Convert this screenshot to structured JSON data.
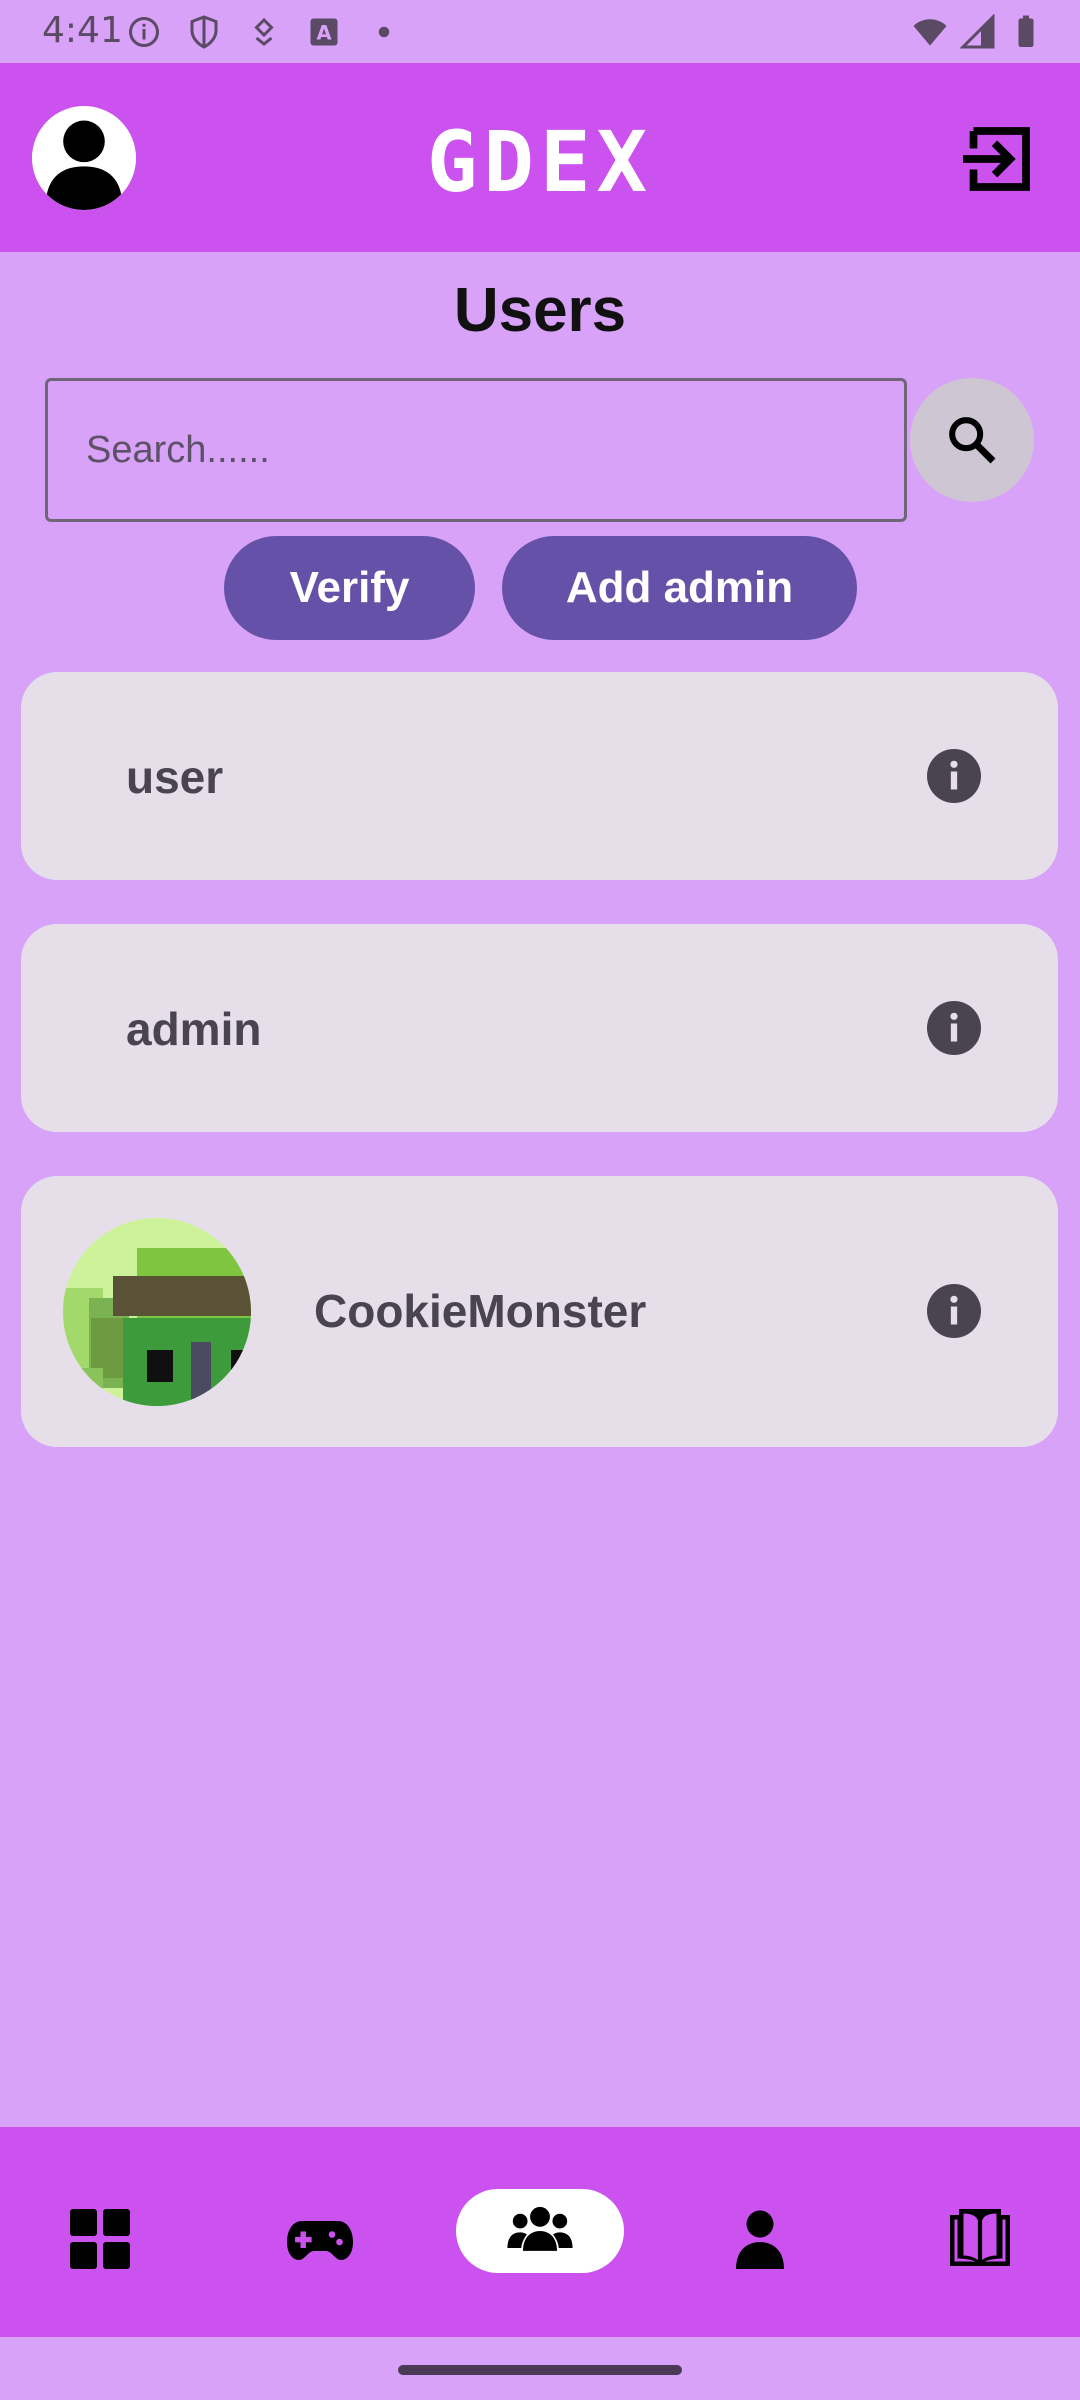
{
  "status_bar": {
    "time": "4:41",
    "left_icons": [
      "info-icon",
      "shield-icon",
      "download-icon",
      "text-icon",
      "dot-icon"
    ],
    "right_icons": [
      "wifi-icon",
      "signal-icon",
      "battery-icon"
    ]
  },
  "app_bar": {
    "title": "GDEX",
    "left_icon": "account-circle-icon",
    "right_icon": "logout-icon"
  },
  "page": {
    "title": "Users"
  },
  "search": {
    "placeholder": "Search......",
    "button_icon": "search-icon"
  },
  "actions": {
    "verify_label": "Verify",
    "add_admin_label": "Add admin"
  },
  "users": [
    {
      "name": "user",
      "has_avatar": false
    },
    {
      "name": "admin",
      "has_avatar": false
    },
    {
      "name": "CookieMonster",
      "has_avatar": true
    }
  ],
  "bottom_nav": {
    "items": [
      {
        "icon": "dashboard-icon",
        "active": false
      },
      {
        "icon": "gamepad-icon",
        "active": false
      },
      {
        "icon": "group-icon",
        "active": true
      },
      {
        "icon": "person-icon",
        "active": false
      },
      {
        "icon": "book-icon",
        "active": false
      }
    ]
  },
  "colors": {
    "background": "#d9a2f9",
    "app_bar": "#cc52f0",
    "button": "#6552a8",
    "card": "#e6dfea"
  }
}
